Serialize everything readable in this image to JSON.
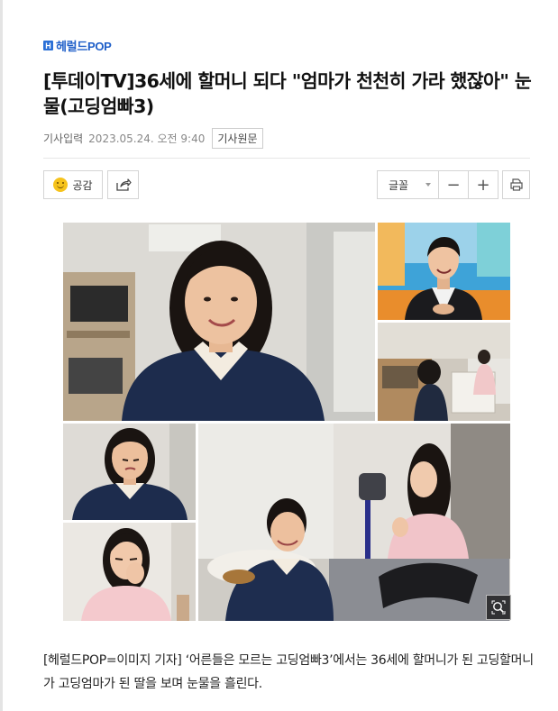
{
  "brand": {
    "logo_text": "헤럴드POP",
    "color": "#1f5fc9"
  },
  "article": {
    "title": "[투데이TV]36세에 할머니 되다 \"엄마가 천천히 가라 했잖아\" 눈물(고딩엄빠3)",
    "published_label": "기사입력",
    "published_date": "2023.05.24. 오전 9:40",
    "original_button": "기사원문",
    "body": "[헤럴드POP=이미지 기자] ‘어른들은 모르는 고딩엄빠3’에서는 36세에 할머니가 된 고딩할머니가 고딩엄마가 된 딸을 보며 눈물을 흘린다."
  },
  "toolbar": {
    "like_label": "공감",
    "like_icon": "smile-emoji-icon",
    "share_icon": "share-icon",
    "font_label": "글꼴",
    "font_icon": "caret-down-icon",
    "decrease_label": "−",
    "increase_label": "+",
    "print_icon": "print-icon"
  },
  "image": {
    "zoom_icon": "zoom-icon"
  }
}
